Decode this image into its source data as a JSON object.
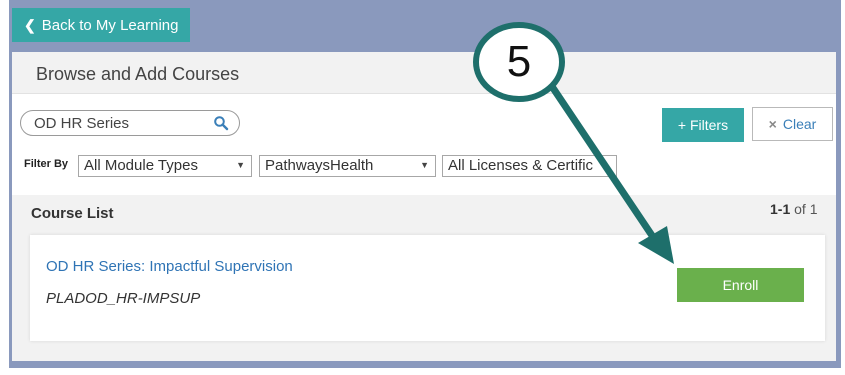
{
  "nav": {
    "back_label": "Back to My Learning"
  },
  "header": {
    "title": "Browse and Add Courses"
  },
  "search": {
    "value": "OD HR Series"
  },
  "buttons": {
    "filters_label": "+ Filters",
    "clear_label": "Clear",
    "clear_x": "×"
  },
  "filter_by": {
    "label": "Filter By",
    "module_types": "All Module Types",
    "organization": "PathwaysHealth",
    "licenses": "All Licenses & Certific"
  },
  "course_list": {
    "title": "Course List",
    "pager_range": "1-1",
    "pager_rest": " of 1",
    "items": [
      {
        "title": "OD HR Series: Impactful Supervision",
        "code": "PLADOD_HR-IMPSUP",
        "action": "Enroll"
      }
    ]
  },
  "callout": {
    "number": "5"
  },
  "colors": {
    "teal": "#35a7a6",
    "green": "#6ab04c",
    "link": "#2f74b5",
    "frame": "#8a99bd",
    "callout_arrow": "#1e6f6b"
  }
}
